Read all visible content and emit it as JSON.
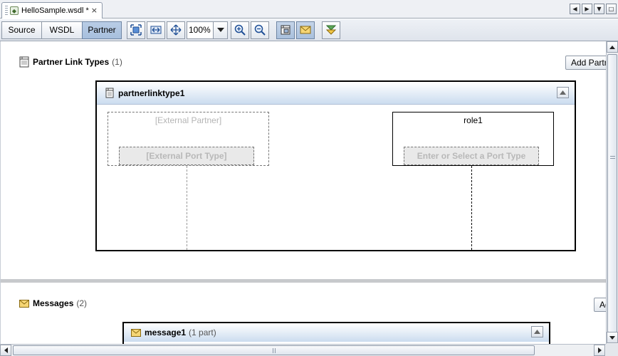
{
  "document_tab": {
    "title": "HelloSample.wsdl *",
    "close": "×"
  },
  "window_controls": {
    "prev": "◀",
    "next": "▶",
    "menu": "▼",
    "maximize": "□"
  },
  "toolbar": {
    "views": [
      {
        "label": "Source",
        "active": false
      },
      {
        "label": "WSDL",
        "active": false
      },
      {
        "label": "Partner",
        "active": true
      }
    ],
    "zoom": {
      "value": "100%"
    },
    "icons": [
      "fit-diagram-icon",
      "fit-width-icon",
      "fit-height-icon",
      "zoom-in-icon",
      "zoom-out-icon",
      "partner-link-type-view-icon",
      "messages-view-icon",
      "expand-all-icon"
    ]
  },
  "partner_link_types": {
    "title": "Partner Link Types",
    "count": "(1)",
    "add_button": "Add Partner",
    "items": [
      {
        "name": "partnerlinktype1",
        "external_partner": {
          "label": "[External Partner]",
          "port_type": "[External Port Type]"
        },
        "role": {
          "label": "role1",
          "port_type": "Enter or Select a Port Type"
        }
      }
    ]
  },
  "messages": {
    "title": "Messages",
    "count": "(2)",
    "add_button": "Add",
    "items": [
      {
        "name": "message1",
        "parts": "(1 part)"
      }
    ]
  },
  "colors": {
    "selected_view": "#a9c0dd",
    "header_gradient_end": "#cbdcef",
    "accent_border": "#000000"
  }
}
